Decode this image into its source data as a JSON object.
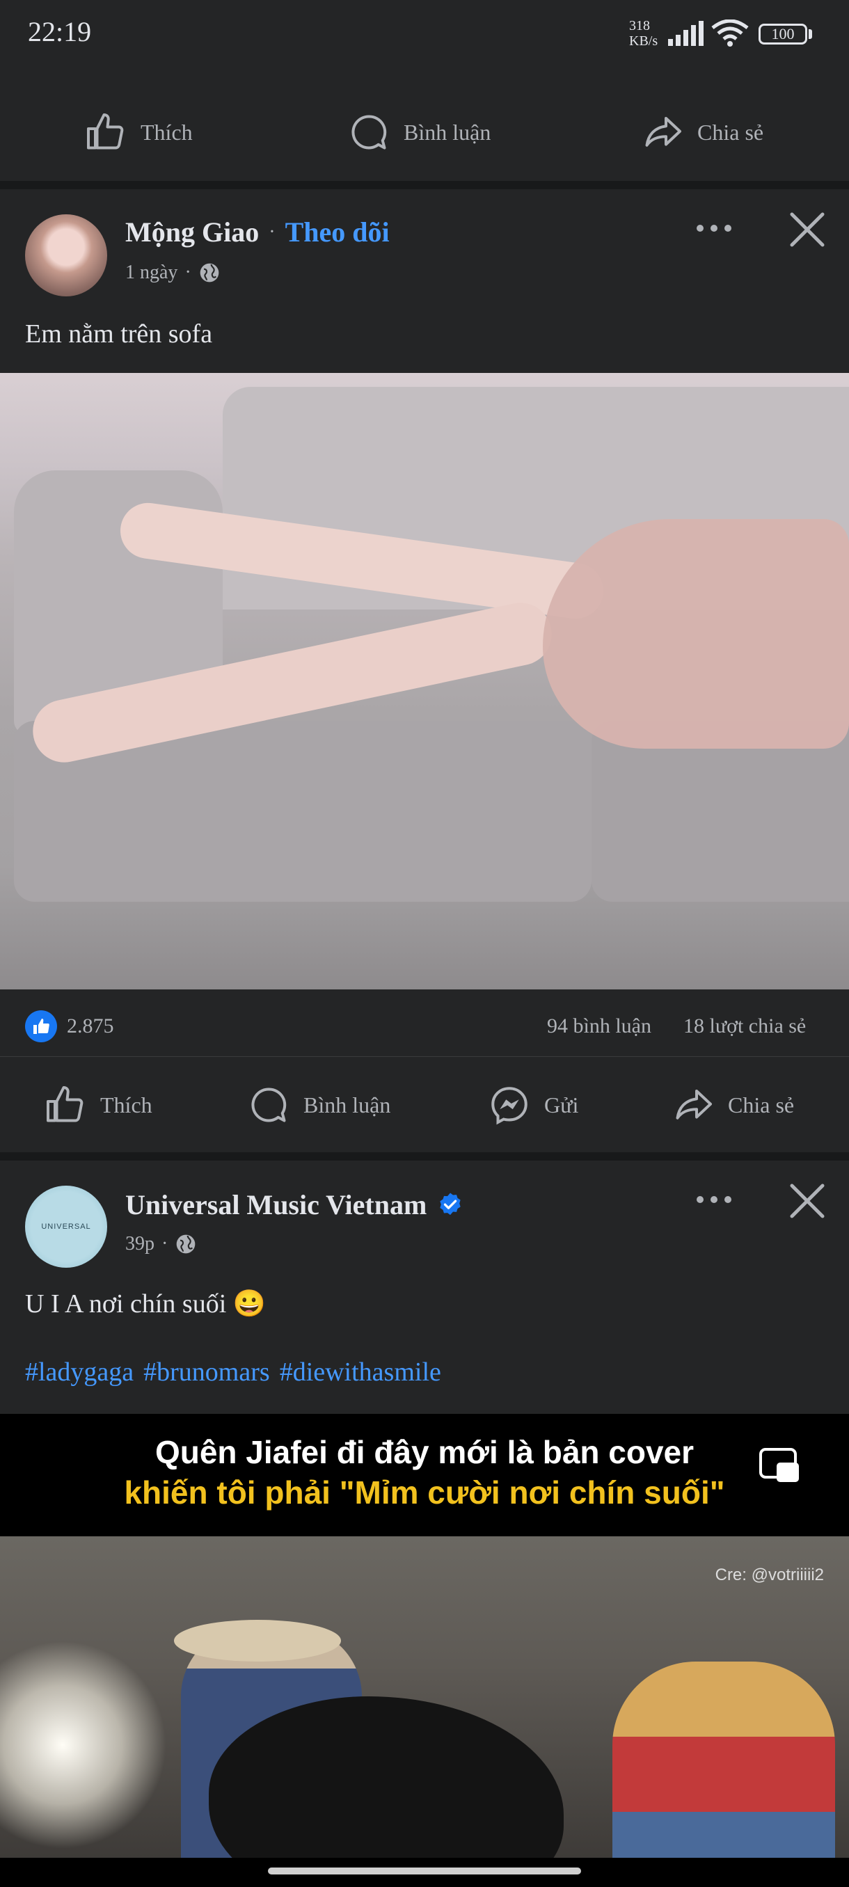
{
  "status_bar": {
    "time": "22:19",
    "speed_value": "318",
    "speed_unit": "KB/s",
    "battery": "100"
  },
  "prev_post": {
    "actions": [
      "Thích",
      "Bình luận",
      "Chia sẻ"
    ]
  },
  "post1": {
    "author": "Mộng Giao",
    "follow": "Theo dõi",
    "time": "1 ngày",
    "separator": "·",
    "text": "Em nằm trên sofa",
    "likes": "2.875",
    "comments": "94 bình luận",
    "shares": "18 lượt chia sẻ",
    "actions": [
      "Thích",
      "Bình luận",
      "Gửi",
      "Chia sẻ"
    ]
  },
  "post2": {
    "author": "Universal Music Vietnam",
    "verified": true,
    "time": "39p",
    "separator": "·",
    "text": "U I A nơi chín suối 😀",
    "hashtags": [
      "#ladygaga",
      "#brunomars",
      "#diewithasmile"
    ],
    "video_title_line1": "Quên Jiafei đi đây mới là bản cover",
    "video_title_line2": "khiến tôi phải \"Mỉm cười nơi chín suối\"",
    "video_credit": "Cre: @votriiiii2",
    "avatar_text": "UNIVERSAL"
  },
  "colors": {
    "background": "#18191a",
    "panel": "#242526",
    "link_blue": "#4599ff",
    "like_blue": "#1877f2",
    "banner_yellow": "#f2c11e"
  }
}
